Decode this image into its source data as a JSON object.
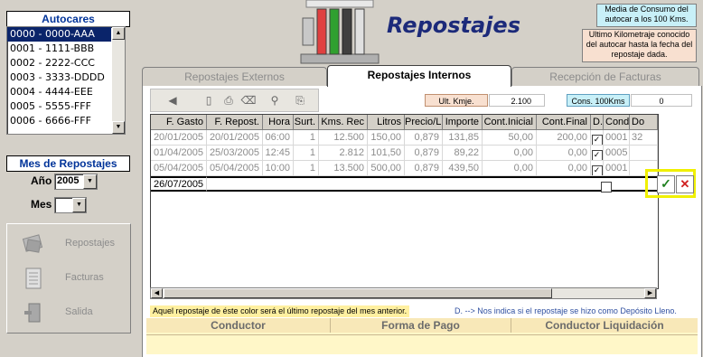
{
  "left": {
    "autocares_title": "Autocares",
    "autocares": [
      "0000 - 0000-AAA",
      "0001 - 1111-BBB",
      "0002 - 2222-CCC",
      "0003 - 3333-DDDD",
      "0004 - 4444-EEE",
      "0005 - 5555-FFF",
      "0006 - 6666-FFF"
    ],
    "mes_title": "Mes de Repostajes",
    "ano_label": "Año",
    "ano_value": "2005",
    "mes_label": "Mes",
    "mes_value": "",
    "nav": {
      "repostajes": "Repostajes",
      "facturas": "Facturas",
      "salida": "Salida"
    }
  },
  "header": {
    "title": "Repostajes",
    "info1": "Media de Consumo del autocar a los 100 Kms.",
    "info2": "Ultimo Kilometraje conocido del autocar hasta la fecha del repostaje dada."
  },
  "tabs": [
    "Repostajes Externos",
    "Repostajes Internos",
    "Recepción de Facturas"
  ],
  "kms": {
    "ult_label": "Ult. Kmje.",
    "ult_value": "2.100",
    "cons_label": "Cons. 100Kms",
    "cons_value": "0"
  },
  "grid": {
    "headers": [
      "F. Gasto",
      "F. Repost.",
      "Hora",
      "Surt.",
      "Kms. Rec",
      "Litros",
      "Precio/L",
      "Importe",
      "Cont.Inicial",
      "Cont.Final",
      "D.",
      "Cond.",
      "Do"
    ],
    "rows": [
      [
        "20/01/2005",
        "20/01/2005",
        "06:00",
        "1",
        "12.500",
        "150,00",
        "0,879",
        "131,85",
        "50,00",
        "200,00",
        "✓",
        "0001",
        "32"
      ],
      [
        "01/04/2005",
        "25/03/2005",
        "12:45",
        "1",
        "2.812",
        "101,50",
        "0,879",
        "89,22",
        "0,00",
        "0,00",
        "✓",
        "0005",
        ""
      ],
      [
        "05/04/2005",
        "05/04/2005",
        "10:00",
        "1",
        "13.500",
        "500,00",
        "0,879",
        "439,50",
        "0,00",
        "0,00",
        "✓",
        "0001",
        ""
      ]
    ],
    "new_row_date": "26/07/2005"
  },
  "notes": {
    "left": "Aquel repostaje de éste color será el último repostaje del mes anterior.",
    "right": "D. --> Nos indica si el repostaje se hizo como Depósito Lleno."
  },
  "bottom": {
    "conductor": "Conductor",
    "forma_pago": "Forma de Pago",
    "liquidacion": "Conductor Liquidación"
  },
  "colors": {
    "selected": "#0a246a",
    "title_blue": "#1c2a7a",
    "info1_bg": "#c8f0f8",
    "info2_bg": "#f8e0d0",
    "note_yellow": "#fff0a0",
    "highlight": "#f0f000"
  }
}
